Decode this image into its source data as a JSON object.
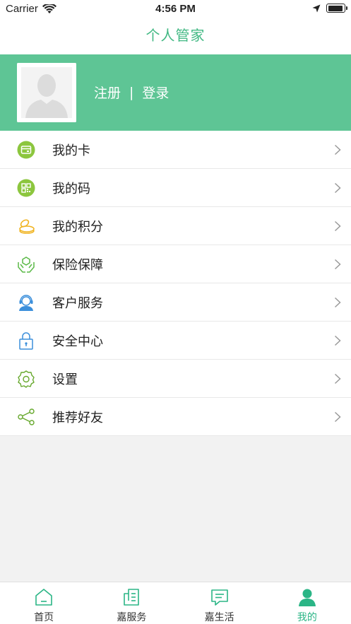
{
  "status_bar": {
    "carrier": "Carrier",
    "time": "4:56 PM"
  },
  "header": {
    "title": "个人管家"
  },
  "profile": {
    "register_label": "注册",
    "separator": "|",
    "login_label": "登录"
  },
  "menu": {
    "items": [
      {
        "label": "我的卡",
        "icon": "card-icon"
      },
      {
        "label": "我的码",
        "icon": "qr-code-icon"
      },
      {
        "label": "我的积分",
        "icon": "coins-icon"
      },
      {
        "label": "保险保障",
        "icon": "insurance-shield-icon"
      },
      {
        "label": "客户服务",
        "icon": "customer-service-icon"
      },
      {
        "label": "安全中心",
        "icon": "lock-icon"
      },
      {
        "label": "设置",
        "icon": "gear-icon"
      },
      {
        "label": "推荐好友",
        "icon": "share-icon"
      }
    ]
  },
  "tab_bar": {
    "tabs": [
      {
        "label": "首页",
        "icon": "home-icon"
      },
      {
        "label": "嘉服务",
        "icon": "service-doc-icon"
      },
      {
        "label": "嘉生活",
        "icon": "chat-icon"
      },
      {
        "label": "我的",
        "icon": "person-icon",
        "active": true
      }
    ]
  },
  "colors": {
    "brand_green": "#5ec595",
    "title_green": "#41b883",
    "active_tab": "#2bb586"
  }
}
